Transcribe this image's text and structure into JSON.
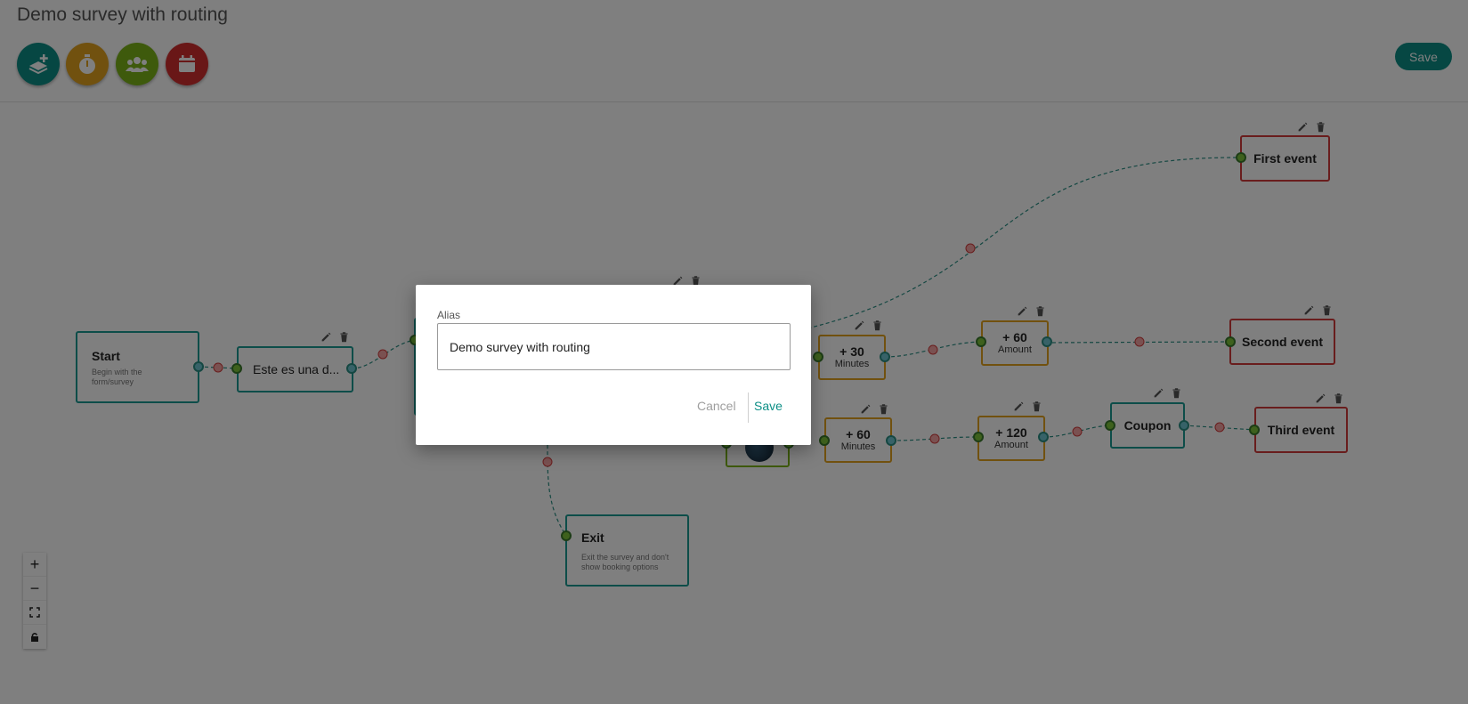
{
  "page": {
    "title": "Demo survey with routing"
  },
  "toolbar": {
    "save_label": "Save",
    "tools": [
      {
        "icon": "layers-add-icon",
        "color": "#0d8f86"
      },
      {
        "icon": "stopwatch-icon",
        "color": "#e2a21e"
      },
      {
        "icon": "users-icon",
        "color": "#7cb518"
      },
      {
        "icon": "calendar-icon",
        "color": "#d32f2f"
      }
    ]
  },
  "nodes": {
    "start": {
      "title": "Start",
      "subtitle": "Begin with the form/survey"
    },
    "question": {
      "title": "Este es una d..."
    },
    "exit": {
      "title": "Exit",
      "subtitle": "Exit the survey and don't show booking options"
    },
    "delay_a": {
      "value": "+ 30",
      "unit": "Minutes"
    },
    "amount_a": {
      "value": "+ 60",
      "unit": "Amount"
    },
    "delay_b": {
      "value": "+ 60",
      "unit": "Minutes"
    },
    "amount_b": {
      "value": "+ 120",
      "unit": "Amount"
    },
    "coupon": {
      "title": "Coupon"
    },
    "first_event": {
      "title": "First event"
    },
    "second_event": {
      "title": "Second event"
    },
    "third_event": {
      "title": "Third event"
    }
  },
  "zoom": {
    "in": "+",
    "out": "−"
  },
  "dialog": {
    "label": "Alias",
    "value": "Demo survey with routing",
    "cancel_label": "Cancel",
    "save_label": "Save"
  },
  "colors": {
    "accent": "#0d8f86",
    "event": "#d33a3a",
    "delay": "#e2a21e"
  }
}
